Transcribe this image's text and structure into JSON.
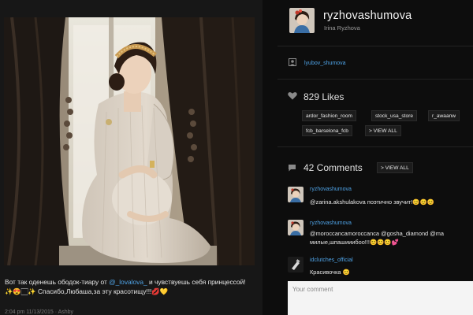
{
  "post": {
    "caption_prefix": "Вот так оденешь ободок-тиару от ",
    "caption_mention": "@_lovalova_",
    "caption_suffix": " и чувствуешь себя принцессой!",
    "caption_line2": "✨😍🏻✨ Спасибо,Любаша,за эту красотищу!!!💋💛",
    "meta": "2:04 pm 11/13/2015 · Ashby"
  },
  "profile": {
    "username": "ryzhovashumova",
    "full_name": "Irina Ryzhova"
  },
  "tagged": {
    "user": "lyubov_shumova"
  },
  "likes": {
    "count_label": "829 Likes",
    "likers": [
      "ardor_fashion_room",
      "stock_usa_store",
      "r_awaanw",
      "fcb_barselona_fcb"
    ],
    "view_all": "> VIEW ALL"
  },
  "comments": {
    "count_label": "42 Comments",
    "view_all": "> VIEW ALL",
    "items": [
      {
        "user": "ryzhovashumova",
        "text": "@zarina.akshulakova поэтично звучит!😊😊😊"
      },
      {
        "user": "ryzhovashumova",
        "text": "@moroccancamoroccanca @gosha_diamond @ma",
        "text2": "милые,шпашииибоо!!!😊😊😊💕"
      },
      {
        "user": "idclutches_official",
        "text": "Красивочка 😊"
      }
    ],
    "input_placeholder": "Your comment"
  },
  "colors": {
    "link": "#4fa3e6",
    "background": "#0d0d0d"
  }
}
